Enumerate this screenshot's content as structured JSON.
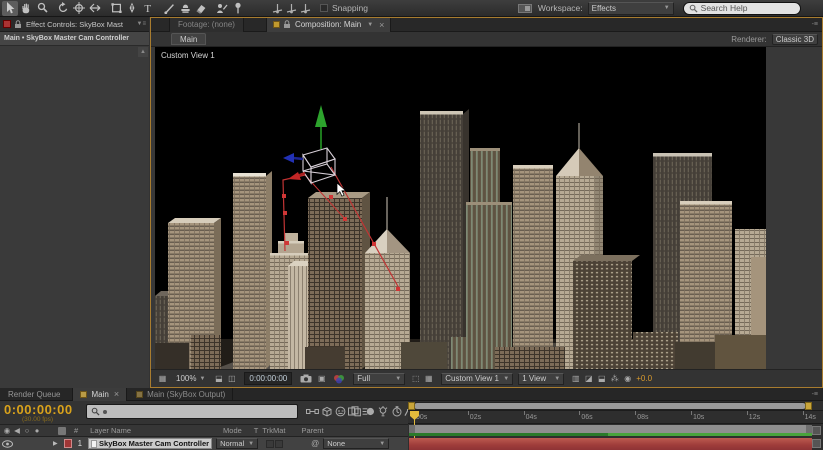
{
  "toolbar": {
    "tools": [
      "selection",
      "hand",
      "zoom",
      "rotate",
      "unified-camera",
      "pan-behind",
      "mask-shape",
      "pen",
      "type",
      "brush",
      "clone-stamp",
      "eraser",
      "roto-brush",
      "puppet-pin"
    ],
    "axis_modes": [
      "local-axis",
      "world-axis",
      "view-axis"
    ],
    "snapping_label": "Snapping",
    "workspace_label": "Workspace:",
    "workspace_value": "Effects",
    "search_placeholder": "Search Help"
  },
  "effect_controls": {
    "tab_title": "Effect Controls: SkyBox Mast",
    "breadcrumb": "Main • SkyBox Master Cam Controller"
  },
  "composition": {
    "footage_tab": "Footage: (none)",
    "comp_tab": "Composition: Main",
    "nav_tab": "Main",
    "renderer_label": "Renderer:",
    "renderer_value": "Classic 3D",
    "view_label": "Custom View 1",
    "bottom": {
      "zoom": "100%",
      "time": "0:00:00:00",
      "resolution": "Full",
      "view_dropdown": "Custom View 1",
      "layout_dropdown": "1 View",
      "exposure": "+0.0"
    }
  },
  "timeline": {
    "tabs": {
      "render_queue": "Render Queue",
      "main": "Main",
      "output": "Main (SkyBox Output)"
    },
    "time_display": "0:00:00:00",
    "fps_note": "(30.00 fps)",
    "toolbar_icons": [
      "mini-flowchart",
      "draft-3d",
      "shy",
      "frame-blend",
      "motion-blur",
      "brainstorm",
      "auto-keyframe",
      "graph-editor"
    ],
    "columns": {
      "layer_name": "Layer Name",
      "mode": "Mode",
      "t": "T",
      "trkmat": "TrkMat",
      "parent": "Parent"
    },
    "layer": {
      "index": "1",
      "name": "SkyBox Master Cam Controller",
      "mode": "Normal",
      "parent": "None"
    },
    "ruler_labels": [
      ":00s",
      "02s",
      "04s",
      "06s",
      "08s",
      "10s",
      "12s",
      "14s"
    ]
  },
  "glyphs": {
    "dropdown": "▼",
    "close": "×",
    "panel_menu": "▼≡",
    "hash": "#",
    "pickwhip": "@",
    "tri_right": "▶",
    "dash_menu": "-≡"
  }
}
